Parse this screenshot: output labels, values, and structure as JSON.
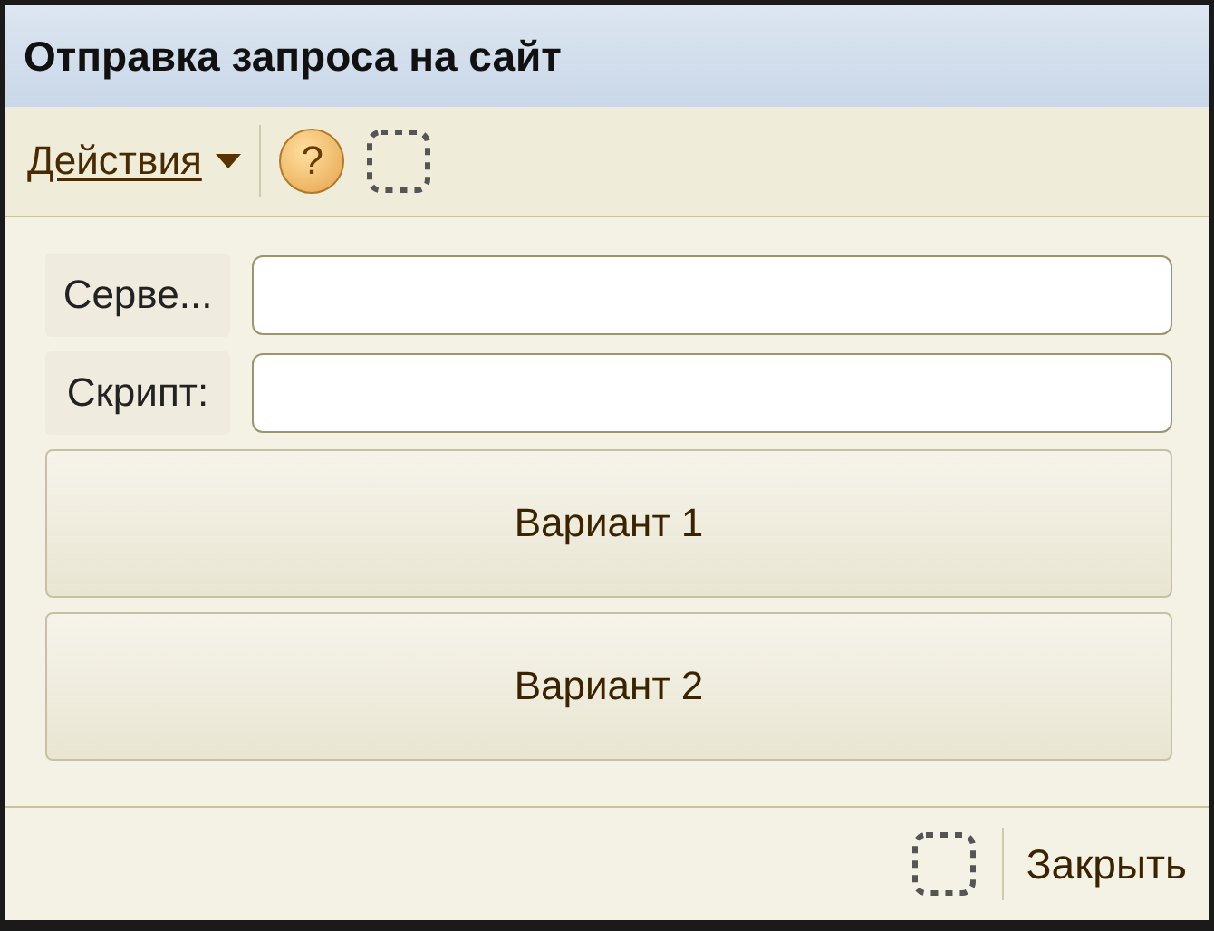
{
  "window": {
    "title": "Отправка запроса на сайт"
  },
  "toolbar": {
    "menu": "Действия",
    "help": "?"
  },
  "fields": [
    {
      "label": "Серве..."
    },
    {
      "label": "Скрипт:"
    }
  ],
  "buttons": [
    "Вариант 1",
    "Вариант 2"
  ],
  "footer": {
    "close": "Закрыть"
  }
}
